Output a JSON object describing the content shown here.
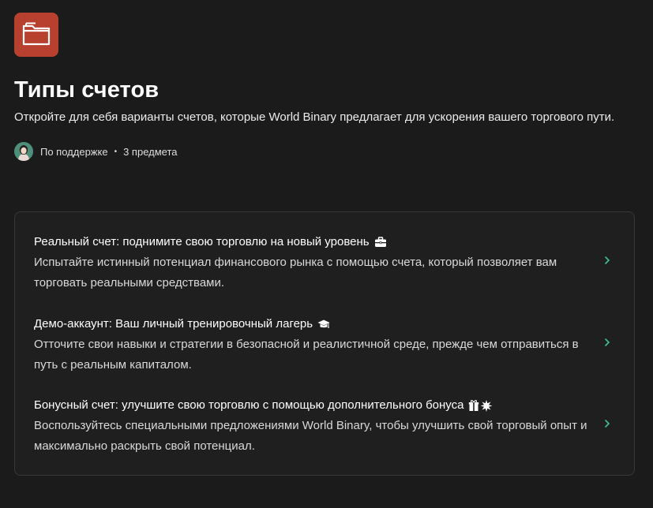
{
  "collection": {
    "icon": "folder-icon",
    "color": "#b8402f",
    "title": "Типы счетов",
    "description": "Откройте для себя варианты счетов, которые World Binary предлагает для ускорения вашего торгового пути."
  },
  "meta": {
    "author": "По поддержке",
    "separator": "•",
    "count": "3 предмета"
  },
  "articles": [
    {
      "title": "Реальный счет: поднимите свою торговлю на новый уровень",
      "emoji": "briefcase-icon",
      "description": "Испытайте истинный потенциал финансового рынка с помощью счета, который позволяет вам торговать реальными средствами."
    },
    {
      "title": "Демо-аккаунт: Ваш личный тренировочный лагерь",
      "emoji": "graduation-cap-icon",
      "description": "Отточите свои навыки и стратегии в безопасной и реалистичной среде, прежде чем отправиться в путь с реальным капиталом."
    },
    {
      "title": "Бонусный счет: улучшите свою торговлю с помощью дополнительного бонуса",
      "emoji": "gift-sparkle-icon",
      "description": "Воспользуйтесь специальными предложениями World Binary, чтобы улучшить свой торговый опыт и максимально раскрыть свой потенциал."
    }
  ],
  "accent": "#3ec29a"
}
